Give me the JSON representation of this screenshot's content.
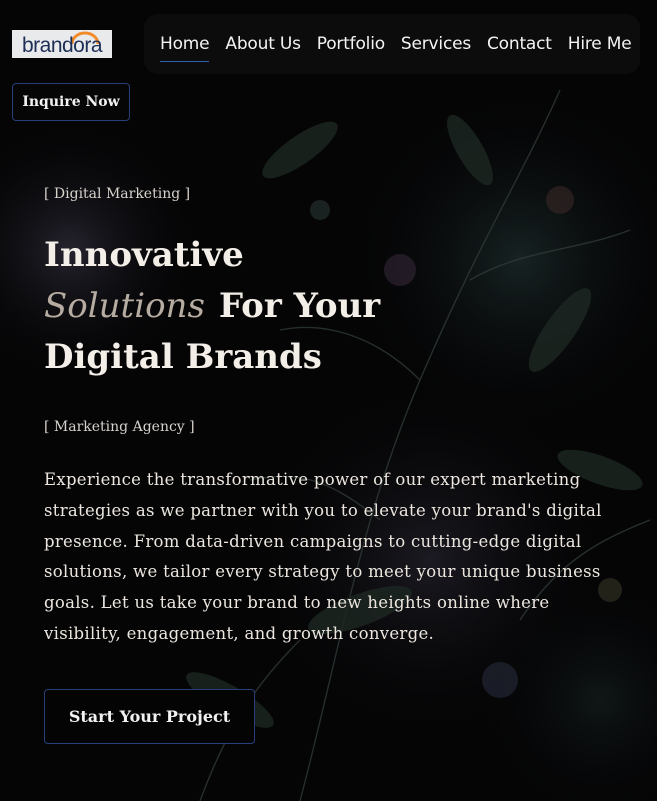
{
  "brand": {
    "logo_text": "brandora",
    "logo_accent_color": "#f28c28"
  },
  "nav": {
    "items": [
      {
        "label": "Home",
        "active": true
      },
      {
        "label": "About Us"
      },
      {
        "label": "Portfolio"
      },
      {
        "label": "Services"
      },
      {
        "label": "Contact"
      },
      {
        "label": "Hire Me"
      }
    ]
  },
  "inquire_button": "Inquire Now",
  "hero": {
    "tag": "[ Digital Marketing ]",
    "headline_line1": "Innovative",
    "headline_italic": "Solutions",
    "headline_line2_rest": "For Your",
    "headline_line3": "Digital Brands",
    "subtag": "[ Marketing Agency ]",
    "paragraph": "Experience the transformative power of our expert marketing strategies as we partner with you to elevate your brand's digital presence. From data-driven campaigns to cutting-edge digital solutions, we tailor every strategy to meet your unique business goals. Let us take your brand to new heights online where visibility, engagement, and growth converge.",
    "cta_label": "Start Your Project"
  },
  "colors": {
    "background": "#050506",
    "button_border": "#27407a",
    "nav_background": "#0c0c0d",
    "italic_accent": "#b6aca1"
  }
}
